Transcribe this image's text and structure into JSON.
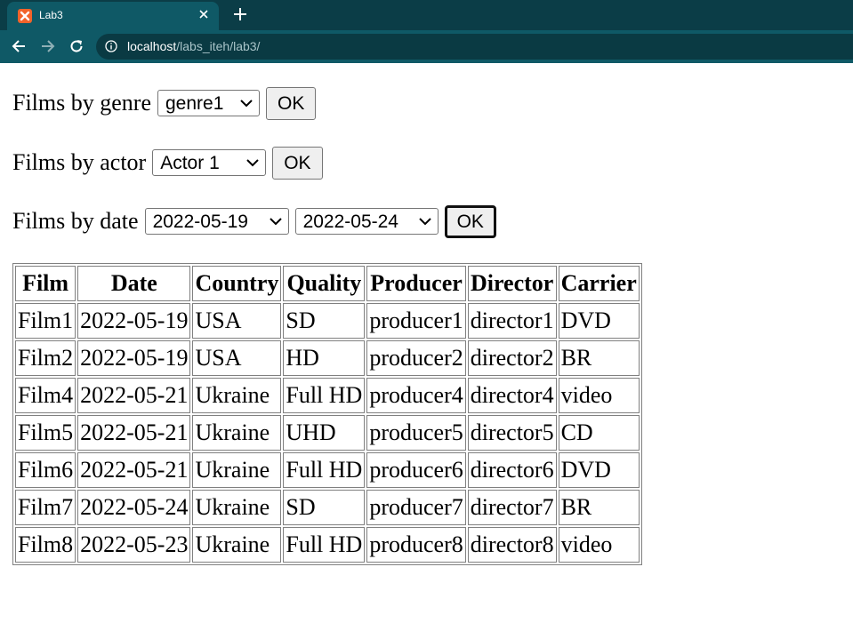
{
  "browser": {
    "tab_title": "Lab3",
    "url_host": "localhost",
    "url_path": "/labs_iteh/lab3/"
  },
  "forms": {
    "genre": {
      "label": "Films by genre",
      "selected": "genre1",
      "ok": "OK"
    },
    "actor": {
      "label": "Films by actor",
      "selected": "Actor 1",
      "ok": "OK"
    },
    "date": {
      "label": "Films by date",
      "from": "2022-05-19",
      "to": "2022-05-24",
      "ok": "OK"
    }
  },
  "table": {
    "headers": [
      "Film",
      "Date",
      "Country",
      "Quality",
      "Producer",
      "Director",
      "Carrier"
    ],
    "rows": [
      [
        "Film1",
        "2022-05-19",
        "USA",
        "SD",
        "producer1",
        "director1",
        "DVD"
      ],
      [
        "Film2",
        "2022-05-19",
        "USA",
        "HD",
        "producer2",
        "director2",
        "BR"
      ],
      [
        "Film4",
        "2022-05-21",
        "Ukraine",
        "Full HD",
        "producer4",
        "director4",
        "video"
      ],
      [
        "Film5",
        "2022-05-21",
        "Ukraine",
        "UHD",
        "producer5",
        "director5",
        "CD"
      ],
      [
        "Film6",
        "2022-05-21",
        "Ukraine",
        "Full HD",
        "producer6",
        "director6",
        "DVD"
      ],
      [
        "Film7",
        "2022-05-24",
        "Ukraine",
        "SD",
        "producer7",
        "director7",
        "BR"
      ],
      [
        "Film8",
        "2022-05-23",
        "Ukraine",
        "Full HD",
        "producer8",
        "director8",
        "video"
      ]
    ]
  },
  "icons": {
    "favicon": "xampp-icon",
    "close": "close-icon",
    "new_tab": "plus-icon",
    "back": "back-arrow-icon",
    "forward": "forward-arrow-icon",
    "reload": "reload-icon",
    "site_info": "info-icon",
    "dropdown": "chevron-down-icon"
  },
  "colors": {
    "tab_strip": "#0b3d47",
    "toolbar": "#0f5966",
    "favicon": "#f2632a"
  }
}
